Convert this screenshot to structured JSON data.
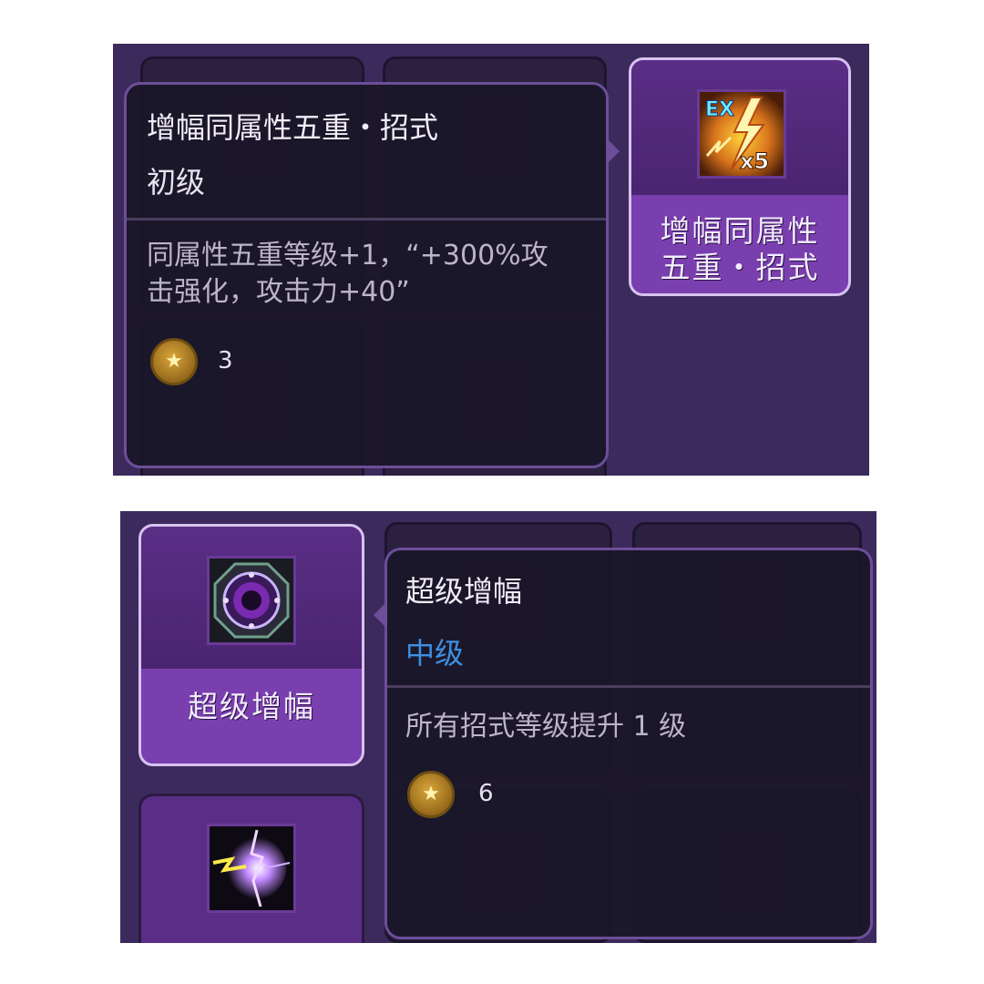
{
  "colors": {
    "panel_bg": "#3d2a5c",
    "card_selected": "#7a3fae",
    "tooltip_bg": "#1b1628",
    "level_basic": "#e8e3ef",
    "level_mid": "#3d8fe0",
    "coin_gold": "#d9a63a"
  },
  "top": {
    "tooltip": {
      "title": "增幅同属性五重・招式",
      "level": "初级",
      "level_color": "#e8e3ef",
      "desc_line1": "同属性五重等级+1，“+300%攻",
      "desc_line2": "击强化，攻击力+40”",
      "cost": "3",
      "coin_icon": "star-coin-icon"
    },
    "selected_card": {
      "icon": "ex-lightning-x5-icon",
      "icon_badge_ex": "EX",
      "icon_badge_x": "x5",
      "label_line1": "增幅同属性",
      "label_line2": "五重・招式"
    }
  },
  "bottom": {
    "tooltip": {
      "title": "超级增幅",
      "level": "中级",
      "level_color": "#3d8fe0",
      "desc_line1": "所有招式等级提升 1 级",
      "cost": "6",
      "coin_icon": "star-coin-icon"
    },
    "selected_card": {
      "icon": "purple-orb-icon",
      "label": "超级增幅"
    },
    "next_card": {
      "icon": "lightning-strike-icon"
    }
  }
}
